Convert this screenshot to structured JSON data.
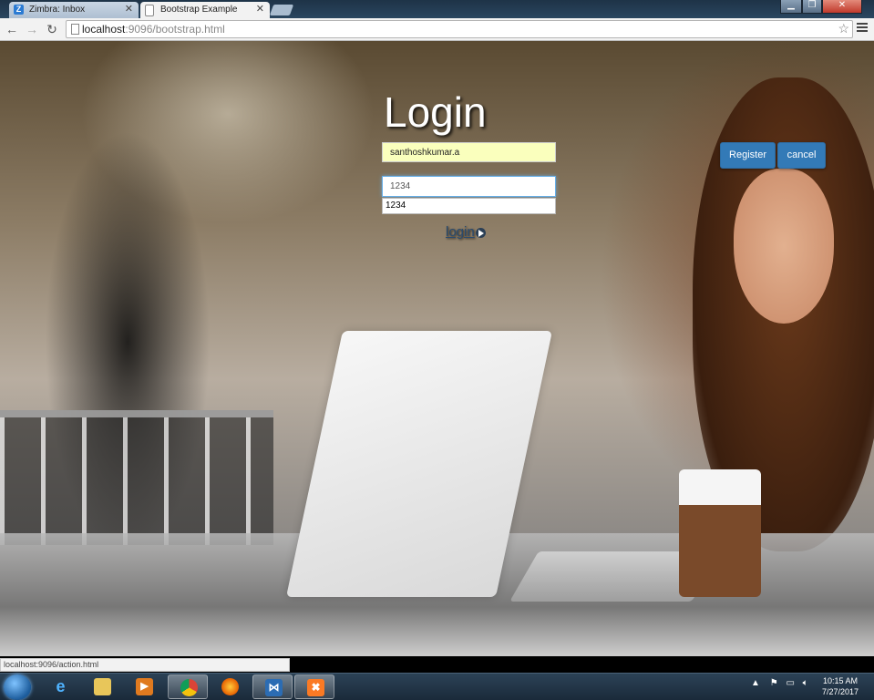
{
  "browser": {
    "tabs": [
      {
        "title": "Zimbra: Inbox",
        "icon": "zimbra-icon",
        "active": false
      },
      {
        "title": "Bootstrap Example",
        "icon": "page-icon",
        "active": true
      }
    ],
    "url_host": "localhost",
    "url_rest": ":9096/bootstrap.html"
  },
  "form": {
    "title": "Login",
    "username_value": "santhoshkumar.a",
    "password_value": "1234",
    "autocomplete_suggestion": "1234",
    "login_link_label": "login"
  },
  "header_buttons": {
    "register_label": "Register",
    "cancel_label": "cancel"
  },
  "status_bar": {
    "text": "localhost:9096/action.html"
  },
  "taskbar": {
    "items": [
      "internet-explorer-icon",
      "file-explorer-icon",
      "media-player-icon",
      "chrome-icon",
      "firefox-icon",
      "visual-studio-icon",
      "xampp-icon"
    ],
    "active_item": "chrome-icon",
    "time": "10:15 AM",
    "date": "7/27/2017"
  },
  "colors": {
    "primary_button": "#337ab7",
    "autofill_yellow": "#faffbd",
    "focus_border": "#66afe9"
  }
}
